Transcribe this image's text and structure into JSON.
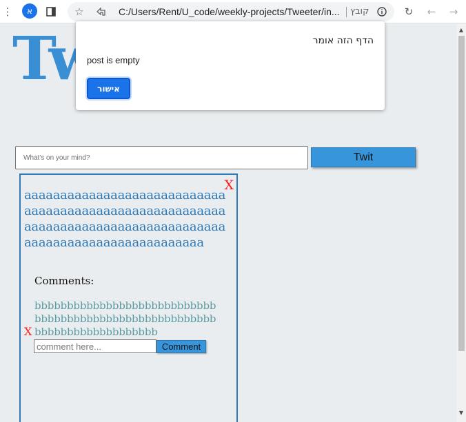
{
  "browser": {
    "url": "C:/Users/Rent/U_code/weekly-projects/Tweeter/in...",
    "file_label": "קובץ",
    "profile_initial": "א",
    "icons": {
      "menu": "more-vert-icon",
      "side_panel": "side-panel-icon",
      "bookmark": "star-icon",
      "share": "share-icon",
      "info": "info-icon",
      "reload": "reload-icon",
      "back": "arrow-back-icon",
      "forward": "arrow-forward-icon"
    }
  },
  "page": {
    "logo_text": "Tw",
    "post_input": {
      "placeholder": "What's on your mind?",
      "value": ""
    },
    "twit_button": "Twit",
    "post": {
      "delete_label": "X",
      "text": "aaaaaaaaaaaaaaaaaaaaaaaaaaaaaaaaaaaaaaaaaaaaaaaaaaaaaaaaaaaaaaaaaaaaaaaaaaaaaaaaaaaaaaaaaaaaaaaaaaaaaaaaaaaaa",
      "comments_title": "Comments:",
      "comments": [
        {
          "text": "bbbbbbbbbbbbbbbbbbbbbbbbbbbbbbbbbbbbbbbbbbbbbbbbbbbbbbbbbbbbbbbbbbbbbbbbbbb",
          "delete_label": "X"
        }
      ],
      "comment_input": {
        "placeholder": "comment here...",
        "value": ""
      },
      "comment_button": "Comment"
    }
  },
  "dialog": {
    "title": "הדף הזה אומר",
    "message": "post is empty",
    "ok_button": "אישור"
  },
  "colors": {
    "accent": "#3796db",
    "logo": "#3a8fd4",
    "post_text": "#2f79b5",
    "comment_text": "#5a9aa0",
    "delete": "#ff1a1a",
    "dialog_button": "#1a73e8"
  }
}
